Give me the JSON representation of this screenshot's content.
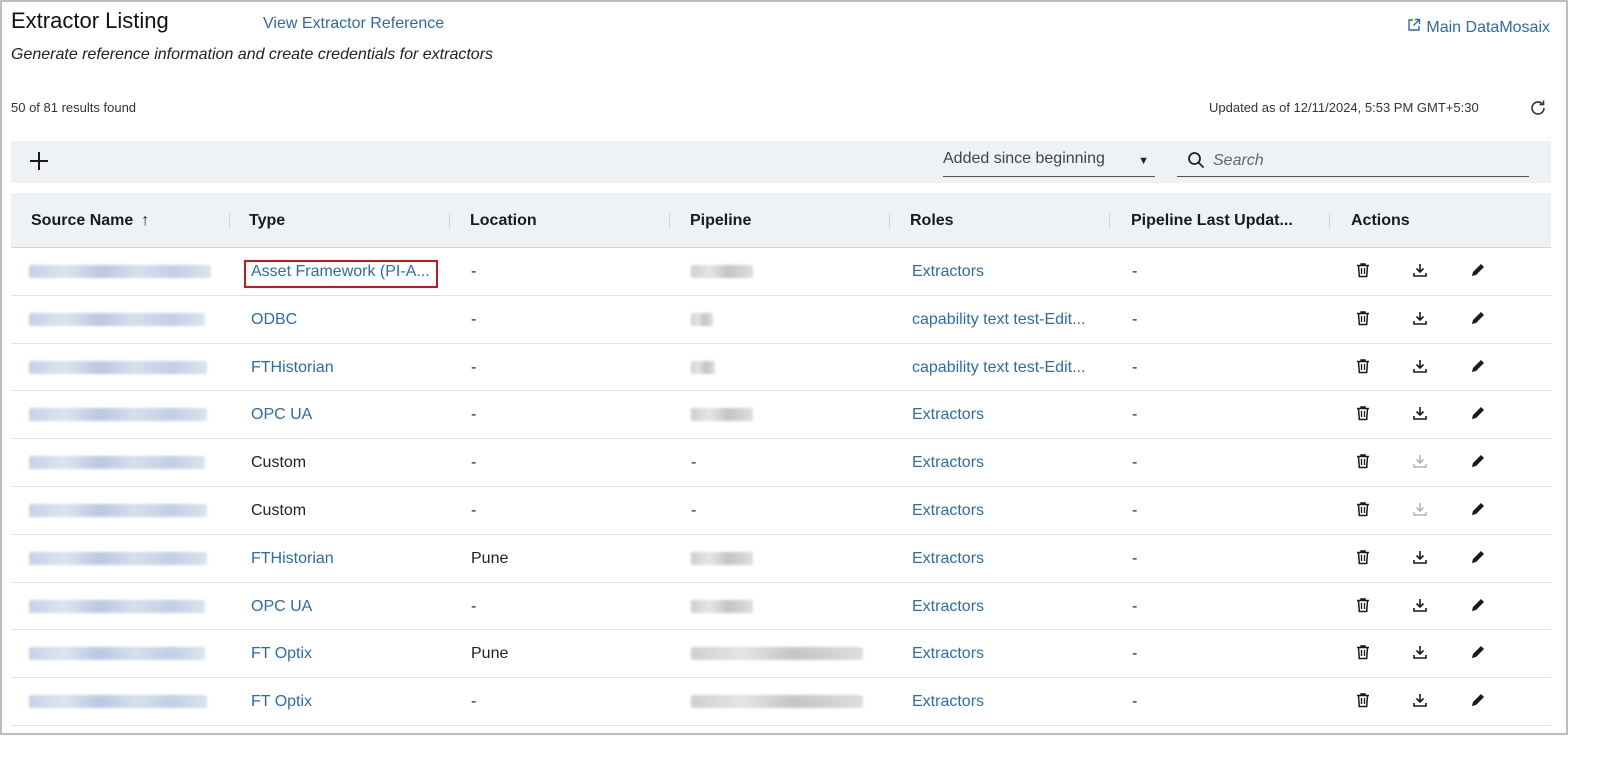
{
  "header": {
    "title": "Extractor Listing",
    "reference_link": "View Extractor Reference",
    "main_link": "Main DataMosaix",
    "subtitle": "Generate reference information and create credentials for extractors"
  },
  "status": {
    "results": "50 of 81 results found",
    "updated": "Updated as of 12/11/2024, 5:53 PM GMT+5:30"
  },
  "toolbar": {
    "filter_value": "Added since beginning",
    "search_placeholder": "Search"
  },
  "table": {
    "columns": [
      "Source Name",
      "Type",
      "Location",
      "Pipeline",
      "Roles",
      "Pipeline Last Updat...",
      "Actions"
    ],
    "rows": [
      {
        "type": "Asset Framework (PI-A...",
        "type_link": true,
        "location": "-",
        "pipeline": "",
        "roles": "Extractors",
        "last_updated": "-",
        "download_enabled": true,
        "highlighted": true
      },
      {
        "type": "ODBC",
        "type_link": true,
        "location": "-",
        "pipeline": "",
        "roles": "capability text test-Edit...",
        "last_updated": "-",
        "download_enabled": true
      },
      {
        "type": "FTHistorian",
        "type_link": true,
        "location": "-",
        "pipeline": "",
        "roles": "capability text test-Edit...",
        "last_updated": "-",
        "download_enabled": true
      },
      {
        "type": "OPC UA",
        "type_link": true,
        "location": "-",
        "pipeline": "",
        "roles": "Extractors",
        "last_updated": "-",
        "download_enabled": true
      },
      {
        "type": "Custom",
        "type_link": false,
        "location": "-",
        "pipeline": "-",
        "roles": "Extractors",
        "last_updated": "-",
        "download_enabled": false
      },
      {
        "type": "Custom",
        "type_link": false,
        "location": "-",
        "pipeline": "-",
        "roles": "Extractors",
        "last_updated": "-",
        "download_enabled": false
      },
      {
        "type": "FTHistorian",
        "type_link": true,
        "location": "Pune",
        "pipeline": "",
        "roles": "Extractors",
        "last_updated": "-",
        "download_enabled": true
      },
      {
        "type": "OPC UA",
        "type_link": true,
        "location": "-",
        "pipeline": "",
        "roles": "Extractors",
        "last_updated": "-",
        "download_enabled": true
      },
      {
        "type": "FT Optix",
        "type_link": true,
        "location": "Pune",
        "pipeline": "",
        "roles": "Extractors",
        "last_updated": "-",
        "download_enabled": true
      },
      {
        "type": "FT Optix",
        "type_link": true,
        "location": "-",
        "pipeline": "",
        "roles": "Extractors",
        "last_updated": "-",
        "download_enabled": true
      }
    ]
  },
  "colors": {
    "link": "#2c6bb0",
    "highlight": "#c8161d",
    "header_bg": "#eef2f5"
  },
  "icons": {
    "add": "plus-icon",
    "refresh": "refresh-icon",
    "external": "external-link-icon",
    "search": "search-icon",
    "delete": "trash-icon",
    "download": "download-icon",
    "edit": "pencil-icon"
  }
}
